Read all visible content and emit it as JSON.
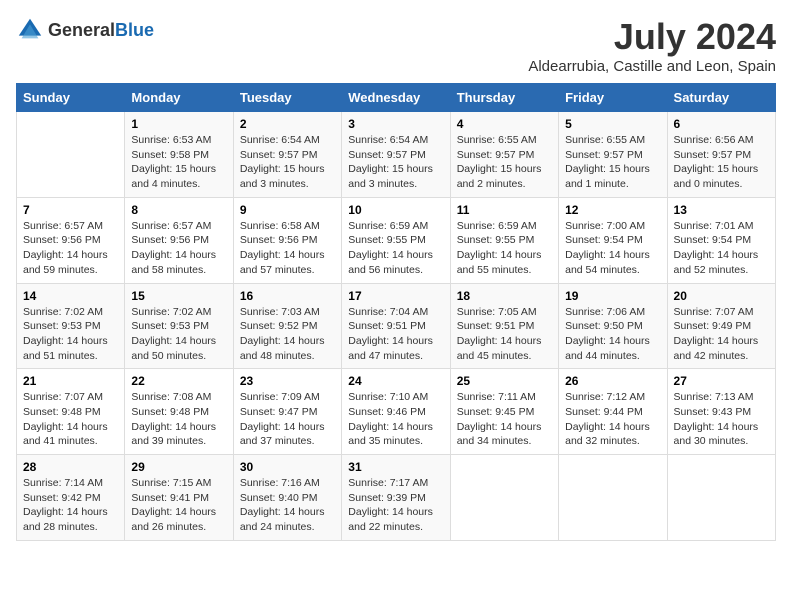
{
  "logo": {
    "general": "General",
    "blue": "Blue"
  },
  "title": {
    "month_year": "July 2024",
    "location": "Aldearrubia, Castille and Leon, Spain"
  },
  "weekdays": [
    "Sunday",
    "Monday",
    "Tuesday",
    "Wednesday",
    "Thursday",
    "Friday",
    "Saturday"
  ],
  "weeks": [
    [
      {
        "day": "",
        "info": ""
      },
      {
        "day": "1",
        "info": "Sunrise: 6:53 AM\nSunset: 9:58 PM\nDaylight: 15 hours\nand 4 minutes."
      },
      {
        "day": "2",
        "info": "Sunrise: 6:54 AM\nSunset: 9:57 PM\nDaylight: 15 hours\nand 3 minutes."
      },
      {
        "day": "3",
        "info": "Sunrise: 6:54 AM\nSunset: 9:57 PM\nDaylight: 15 hours\nand 3 minutes."
      },
      {
        "day": "4",
        "info": "Sunrise: 6:55 AM\nSunset: 9:57 PM\nDaylight: 15 hours\nand 2 minutes."
      },
      {
        "day": "5",
        "info": "Sunrise: 6:55 AM\nSunset: 9:57 PM\nDaylight: 15 hours\nand 1 minute."
      },
      {
        "day": "6",
        "info": "Sunrise: 6:56 AM\nSunset: 9:57 PM\nDaylight: 15 hours\nand 0 minutes."
      }
    ],
    [
      {
        "day": "7",
        "info": "Sunrise: 6:57 AM\nSunset: 9:56 PM\nDaylight: 14 hours\nand 59 minutes."
      },
      {
        "day": "8",
        "info": "Sunrise: 6:57 AM\nSunset: 9:56 PM\nDaylight: 14 hours\nand 58 minutes."
      },
      {
        "day": "9",
        "info": "Sunrise: 6:58 AM\nSunset: 9:56 PM\nDaylight: 14 hours\nand 57 minutes."
      },
      {
        "day": "10",
        "info": "Sunrise: 6:59 AM\nSunset: 9:55 PM\nDaylight: 14 hours\nand 56 minutes."
      },
      {
        "day": "11",
        "info": "Sunrise: 6:59 AM\nSunset: 9:55 PM\nDaylight: 14 hours\nand 55 minutes."
      },
      {
        "day": "12",
        "info": "Sunrise: 7:00 AM\nSunset: 9:54 PM\nDaylight: 14 hours\nand 54 minutes."
      },
      {
        "day": "13",
        "info": "Sunrise: 7:01 AM\nSunset: 9:54 PM\nDaylight: 14 hours\nand 52 minutes."
      }
    ],
    [
      {
        "day": "14",
        "info": "Sunrise: 7:02 AM\nSunset: 9:53 PM\nDaylight: 14 hours\nand 51 minutes."
      },
      {
        "day": "15",
        "info": "Sunrise: 7:02 AM\nSunset: 9:53 PM\nDaylight: 14 hours\nand 50 minutes."
      },
      {
        "day": "16",
        "info": "Sunrise: 7:03 AM\nSunset: 9:52 PM\nDaylight: 14 hours\nand 48 minutes."
      },
      {
        "day": "17",
        "info": "Sunrise: 7:04 AM\nSunset: 9:51 PM\nDaylight: 14 hours\nand 47 minutes."
      },
      {
        "day": "18",
        "info": "Sunrise: 7:05 AM\nSunset: 9:51 PM\nDaylight: 14 hours\nand 45 minutes."
      },
      {
        "day": "19",
        "info": "Sunrise: 7:06 AM\nSunset: 9:50 PM\nDaylight: 14 hours\nand 44 minutes."
      },
      {
        "day": "20",
        "info": "Sunrise: 7:07 AM\nSunset: 9:49 PM\nDaylight: 14 hours\nand 42 minutes."
      }
    ],
    [
      {
        "day": "21",
        "info": "Sunrise: 7:07 AM\nSunset: 9:48 PM\nDaylight: 14 hours\nand 41 minutes."
      },
      {
        "day": "22",
        "info": "Sunrise: 7:08 AM\nSunset: 9:48 PM\nDaylight: 14 hours\nand 39 minutes."
      },
      {
        "day": "23",
        "info": "Sunrise: 7:09 AM\nSunset: 9:47 PM\nDaylight: 14 hours\nand 37 minutes."
      },
      {
        "day": "24",
        "info": "Sunrise: 7:10 AM\nSunset: 9:46 PM\nDaylight: 14 hours\nand 35 minutes."
      },
      {
        "day": "25",
        "info": "Sunrise: 7:11 AM\nSunset: 9:45 PM\nDaylight: 14 hours\nand 34 minutes."
      },
      {
        "day": "26",
        "info": "Sunrise: 7:12 AM\nSunset: 9:44 PM\nDaylight: 14 hours\nand 32 minutes."
      },
      {
        "day": "27",
        "info": "Sunrise: 7:13 AM\nSunset: 9:43 PM\nDaylight: 14 hours\nand 30 minutes."
      }
    ],
    [
      {
        "day": "28",
        "info": "Sunrise: 7:14 AM\nSunset: 9:42 PM\nDaylight: 14 hours\nand 28 minutes."
      },
      {
        "day": "29",
        "info": "Sunrise: 7:15 AM\nSunset: 9:41 PM\nDaylight: 14 hours\nand 26 minutes."
      },
      {
        "day": "30",
        "info": "Sunrise: 7:16 AM\nSunset: 9:40 PM\nDaylight: 14 hours\nand 24 minutes."
      },
      {
        "day": "31",
        "info": "Sunrise: 7:17 AM\nSunset: 9:39 PM\nDaylight: 14 hours\nand 22 minutes."
      },
      {
        "day": "",
        "info": ""
      },
      {
        "day": "",
        "info": ""
      },
      {
        "day": "",
        "info": ""
      }
    ]
  ]
}
